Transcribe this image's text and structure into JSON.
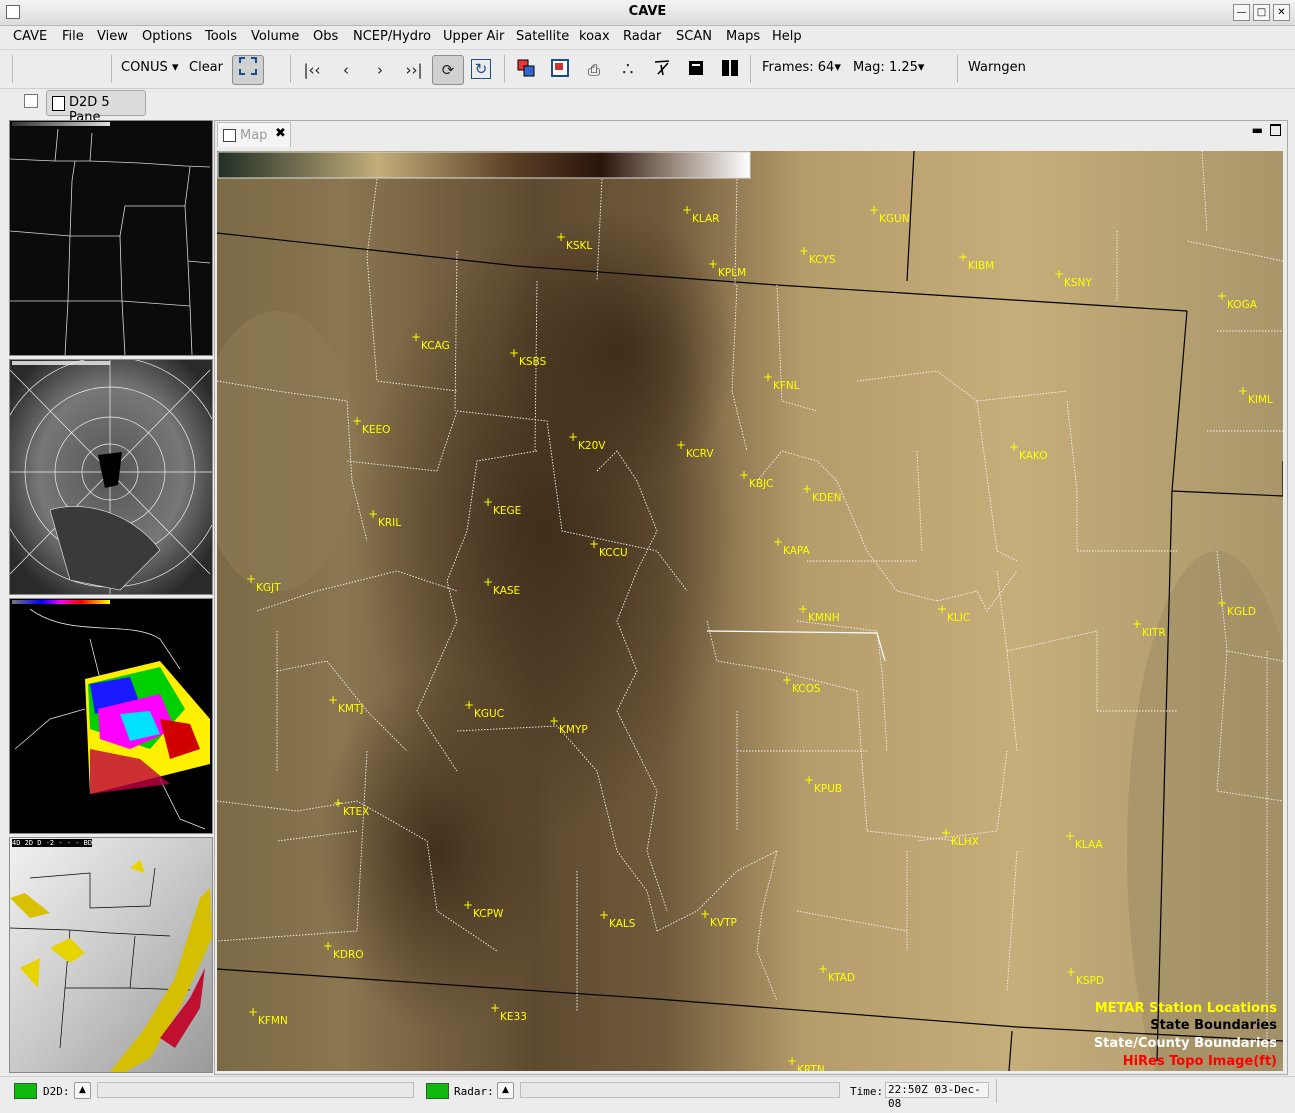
{
  "window": {
    "title": "CAVE"
  },
  "menu": [
    "CAVE",
    "File",
    "View",
    "Options",
    "Tools",
    "Volume",
    "Obs",
    "NCEP/Hydro",
    "Upper Air",
    "Satellite",
    "koax",
    "Radar",
    "SCAN",
    "Maps",
    "Help"
  ],
  "toolbar": {
    "scale": "CONUS",
    "clear": "Clear",
    "frames_label": "Frames: 64",
    "mag_label": "Mag: 1.25",
    "warngen": "Warngen"
  },
  "perspective": {
    "label": "D2D 5 Pane"
  },
  "map_tab": {
    "label": "Map"
  },
  "pane4_header": "4D  2D  D -2 - - - BD",
  "stations": [
    {
      "id": "KLAR"
    },
    {
      "id": "KGUN"
    },
    {
      "id": "KSKL"
    },
    {
      "id": "KCYS"
    },
    {
      "id": "KPLM"
    },
    {
      "id": "KIBM"
    },
    {
      "id": "KSNY"
    },
    {
      "id": "KOGA"
    },
    {
      "id": "KCAG"
    },
    {
      "id": "KSBS"
    },
    {
      "id": "KFNL"
    },
    {
      "id": "KIML"
    },
    {
      "id": "KEEO"
    },
    {
      "id": "K20V"
    },
    {
      "id": "KCRV"
    },
    {
      "id": "KAKO"
    },
    {
      "id": "KBJC"
    },
    {
      "id": "KDEN"
    },
    {
      "id": "KEGE"
    },
    {
      "id": "KRIL"
    },
    {
      "id": "KCCU"
    },
    {
      "id": "KAPA"
    },
    {
      "id": "KGJT"
    },
    {
      "id": "KASE"
    },
    {
      "id": "KMNH"
    },
    {
      "id": "KLIC"
    },
    {
      "id": "KGLD"
    },
    {
      "id": "KITR"
    },
    {
      "id": "KCOS"
    },
    {
      "id": "KMTJ"
    },
    {
      "id": "KGUC"
    },
    {
      "id": "KMYP"
    },
    {
      "id": "KPUB"
    },
    {
      "id": "KTEX"
    },
    {
      "id": "KLHX"
    },
    {
      "id": "KLAA"
    },
    {
      "id": "KCPW"
    },
    {
      "id": "KALS"
    },
    {
      "id": "KVTP"
    },
    {
      "id": "KDRO"
    },
    {
      "id": "KTAD"
    },
    {
      "id": "KSPD"
    },
    {
      "id": "KE33"
    },
    {
      "id": "KFMN"
    },
    {
      "id": "KRTN"
    }
  ],
  "legend": [
    {
      "text": "METAR Station Locations",
      "color": "#ffff00"
    },
    {
      "text": "State Boundaries",
      "color": "#000000"
    },
    {
      "text": "State/County Boundaries",
      "color": "#ffffff"
    },
    {
      "text": "HiRes Topo Image(ft)",
      "color": "#ff0000"
    }
  ],
  "status": {
    "d2d_label": "D2D:",
    "radar_label": "Radar:",
    "time_label": "Time:",
    "time_value": "22:50Z 03-Dec-08"
  }
}
